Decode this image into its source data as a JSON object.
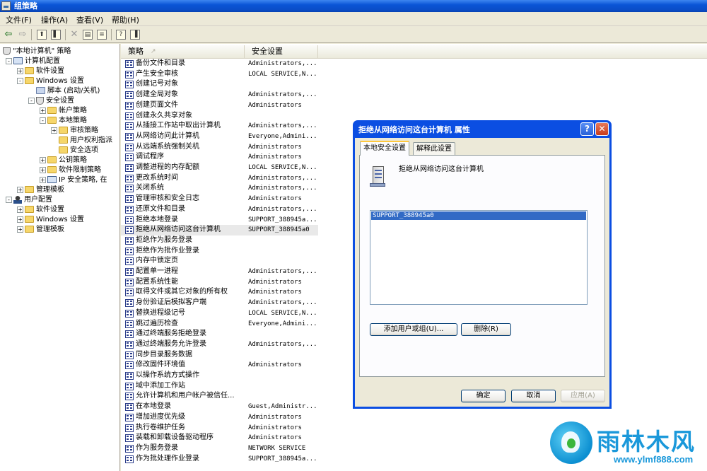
{
  "window": {
    "title": "组策略"
  },
  "menu": [
    "文件(F)",
    "操作(A)",
    "查看(V)",
    "帮助(H)"
  ],
  "tree": [
    {
      "label": "\"本地计算机\" 策略",
      "icon": "policy-icon",
      "exp": ""
    },
    {
      "label": "计算机配置",
      "icon": "computer-icon",
      "exp": "-"
    },
    {
      "label": "软件设置",
      "icon": "folder-icon",
      "exp": "+"
    },
    {
      "label": "Windows 设置",
      "icon": "folder-icon",
      "exp": "-"
    },
    {
      "label": "脚本 (启动/关机)",
      "icon": "script-icon",
      "exp": ""
    },
    {
      "label": "安全设置",
      "icon": "shield-icon",
      "exp": "-"
    },
    {
      "label": "帐户策略",
      "icon": "folder-icon",
      "exp": "+"
    },
    {
      "label": "本地策略",
      "icon": "folder-icon",
      "exp": "-"
    },
    {
      "label": "审核策略",
      "icon": "folder-icon",
      "exp": "+"
    },
    {
      "label": "用户权利指派",
      "icon": "folder-icon",
      "exp": ""
    },
    {
      "label": "安全选项",
      "icon": "folder-icon",
      "exp": ""
    },
    {
      "label": "公钥策略",
      "icon": "folder-icon",
      "exp": "+"
    },
    {
      "label": "软件限制策略",
      "icon": "folder-icon",
      "exp": "+"
    },
    {
      "label": "IP 安全策略, 在",
      "icon": "ip-security-icon",
      "exp": "+"
    },
    {
      "label": "管理模板",
      "icon": "folder-icon",
      "exp": "+"
    },
    {
      "label": "用户配置",
      "icon": "user-icon",
      "exp": "-"
    },
    {
      "label": "软件设置",
      "icon": "folder-icon",
      "exp": "+"
    },
    {
      "label": "Windows 设置",
      "icon": "folder-icon",
      "exp": "+"
    },
    {
      "label": "管理模板",
      "icon": "folder-icon",
      "exp": "+"
    }
  ],
  "list": {
    "col_policy": "策略",
    "col_setting": "安全设置",
    "rows": [
      [
        "备份文件和目录",
        "Administrators,..."
      ],
      [
        "产生安全审核",
        "LOCAL SERVICE,N..."
      ],
      [
        "创建记号对象",
        ""
      ],
      [
        "创建全局对象",
        "Administrators,..."
      ],
      [
        "创建页面文件",
        "Administrators"
      ],
      [
        "创建永久共享对象",
        ""
      ],
      [
        "从插接工作站中取出计算机",
        "Administrators,..."
      ],
      [
        "从网络访问此计算机",
        "Everyone,Admini..."
      ],
      [
        "从远端系统强制关机",
        "Administrators"
      ],
      [
        "调试程序",
        "Administrators"
      ],
      [
        "调整进程的内存配额",
        "LOCAL SERVICE,N..."
      ],
      [
        "更改系统时间",
        "Administrators,..."
      ],
      [
        "关闭系统",
        "Administrators,..."
      ],
      [
        "管理审核和安全日志",
        "Administrators"
      ],
      [
        "还原文件和目录",
        "Administrators,..."
      ],
      [
        "拒绝本地登录",
        "SUPPORT_388945a..."
      ],
      [
        "拒绝从网络访问这台计算机",
        "SUPPORT_388945a0"
      ],
      [
        "拒绝作为服务登录",
        ""
      ],
      [
        "拒绝作为批作业登录",
        ""
      ],
      [
        "内存中锁定页",
        ""
      ],
      [
        "配置单一进程",
        "Administrators,..."
      ],
      [
        "配置系统性能",
        "Administrators"
      ],
      [
        "取得文件或其它对象的所有权",
        "Administrators"
      ],
      [
        "身份验证后模拟客户端",
        "Administrators,..."
      ],
      [
        "替换进程级记号",
        "LOCAL SERVICE,N..."
      ],
      [
        "跳过遍历检查",
        "Everyone,Admini..."
      ],
      [
        "通过终端服务拒绝登录",
        ""
      ],
      [
        "通过终端服务允许登录",
        "Administrators,..."
      ],
      [
        "同步目录服务数据",
        ""
      ],
      [
        "修改固件环境值",
        "Administrators"
      ],
      [
        "以操作系统方式操作",
        ""
      ],
      [
        "域中添加工作站",
        ""
      ],
      [
        "允许计算机和用户帐户被信任...",
        ""
      ],
      [
        "在本地登录",
        "Guest,Administr..."
      ],
      [
        "增加进度优先级",
        "Administrators"
      ],
      [
        "执行卷维护任务",
        "Administrators"
      ],
      [
        "装载和卸载设备驱动程序",
        "Administrators"
      ],
      [
        "作为服务登录",
        "NETWORK SERVICE"
      ],
      [
        "作为批处理作业登录",
        "SUPPORT_388945a..."
      ]
    ]
  },
  "dialog": {
    "title": "拒绝从网络访问这台计算机 属性",
    "tabs": [
      "本地安全设置",
      "解释此设置"
    ],
    "heading": "拒绝从网络访问这台计算机",
    "users": [
      "SUPPORT_388945a0"
    ],
    "add_button": "添加用户或组(U)...",
    "remove_button": "删除(R)",
    "ok_button": "确定",
    "cancel_button": "取消",
    "apply_button": "应用(A)",
    "help_glyph": "?",
    "close_glyph": "✕"
  },
  "watermark": {
    "text": "雨林木风",
    "url": "www.ylmf888.com"
  },
  "colors": {
    "titlebar": "#0a55d6",
    "selection": "#316ac5",
    "dialog_frame": "#0b4ee2"
  }
}
